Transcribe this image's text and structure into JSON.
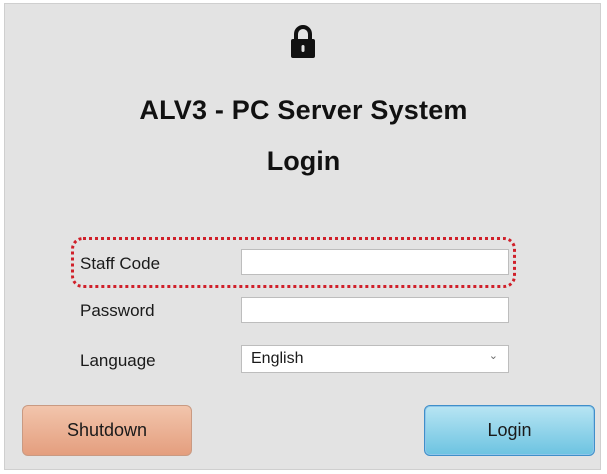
{
  "header": {
    "lock_icon": "padlock-icon",
    "app_title": "ALV3 - PC Server System",
    "subtitle": "Login"
  },
  "form": {
    "staff_code": {
      "label": "Staff Code",
      "value": ""
    },
    "password": {
      "label": "Password",
      "value": ""
    },
    "language": {
      "label": "Language",
      "selected": "English",
      "chevron": "chevron-down-icon"
    }
  },
  "buttons": {
    "shutdown_label": "Shutdown",
    "login_label": "Login"
  },
  "colors": {
    "background": "#e3e3e3",
    "shutdown_button": "#e49e7e",
    "login_button": "#6cc3e1",
    "highlight_outline": "#d0202a"
  }
}
